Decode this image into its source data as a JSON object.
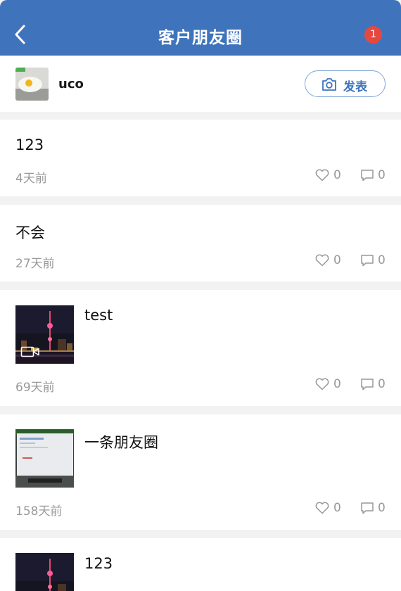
{
  "header": {
    "title": "客户朋友圈",
    "badge": "1"
  },
  "user": {
    "name": "uco"
  },
  "actions": {
    "post_label": "发表"
  },
  "posts": [
    {
      "text": "123",
      "time": "4天前",
      "likes": "0",
      "comments": "0"
    },
    {
      "text": "不会",
      "time": "27天前",
      "likes": "0",
      "comments": "0"
    },
    {
      "text": "test",
      "time": "69天前",
      "likes": "0",
      "comments": "0"
    },
    {
      "text": "一条朋友圈",
      "time": "158天前",
      "likes": "0",
      "comments": "0"
    },
    {
      "text": "123"
    }
  ],
  "icons": {
    "back": "chevron-left-icon",
    "camera": "camera-icon",
    "like": "heart-icon",
    "comment": "comment-icon",
    "video": "video-icon"
  },
  "colors": {
    "header": "#3f74bd",
    "badge": "#e5483f",
    "muted": "#999999"
  }
}
